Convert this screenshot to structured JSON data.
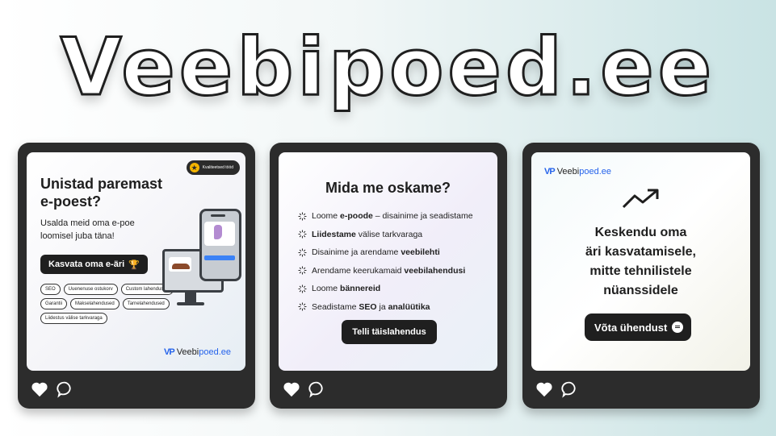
{
  "headline": "Veebipoed.ee",
  "brand": {
    "mark": "VP",
    "name_part1": "Veebi",
    "name_part2": "poed.ee",
    "accent_color": "#2563eb"
  },
  "card1": {
    "badge": "Kvaliteetsed tööd",
    "title_line1": "Unistad paremast",
    "title_line2": "e-poest?",
    "subtitle_line1": "Usalda meid oma e-poe",
    "subtitle_line2": "loomisel juba täna!",
    "cta": "Kasvata oma e-äri",
    "tags": [
      "SEO",
      "Uuenenuse ostukorv",
      "Custom lahendused",
      "Garantii",
      "Makselahendused",
      "Tarnelahendused",
      "Liidestus välise tarkvaraga"
    ]
  },
  "card2": {
    "title": "Mida me oskame?",
    "items": [
      {
        "pre": "Loome ",
        "bold": "e-poode",
        "post": " – disainime ja seadistame"
      },
      {
        "pre": "",
        "bold": "Liidestame",
        "post": " välise tarkvaraga"
      },
      {
        "pre": "Disainime ja arendame ",
        "bold": "veebilehti",
        "post": ""
      },
      {
        "pre": "Arendame keerukamaid ",
        "bold": "veebilahendusi",
        "post": ""
      },
      {
        "pre": "Loome ",
        "bold": "bännereid",
        "post": ""
      },
      {
        "pre": "Seadistame ",
        "bold": "SEO",
        "post": " ja ",
        "bold2": "analüütika"
      }
    ],
    "cta": "Telli täislahendus"
  },
  "card3": {
    "line1": "Keskendu oma",
    "line2": "äri kasvatamisele,",
    "line3": "mitte tehnilistele",
    "line4": "nüanssidele",
    "cta": "Võta ühendust"
  },
  "icons": {
    "like": "heart-icon",
    "comment": "comment-icon",
    "growth": "trend-up-arrow-icon",
    "list": "loader-icon"
  }
}
